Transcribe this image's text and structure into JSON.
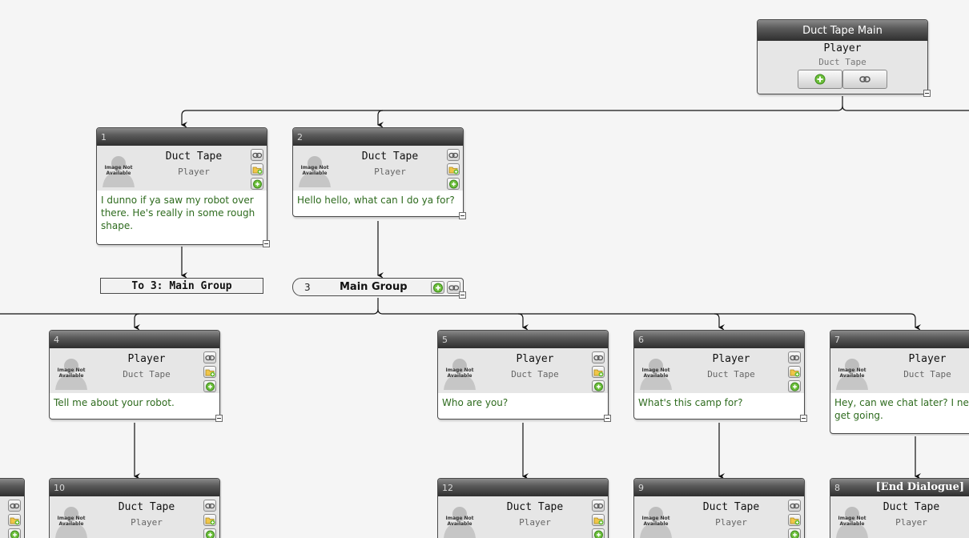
{
  "root": {
    "title": "Duct Tape Main",
    "speaker": "Player",
    "listener": "Duct Tape",
    "buttons": [
      "add-icon",
      "link-icon"
    ]
  },
  "portrait_text": "Image Not Available",
  "nodes": {
    "n1": {
      "id": "1",
      "speaker": "Duct Tape",
      "listener": "Player",
      "text": "I dunno if ya saw my robot over there. He's really in some rough shape."
    },
    "n2": {
      "id": "2",
      "speaker": "Duct Tape",
      "listener": "Player",
      "text": "Hello hello, what can I do ya for?"
    },
    "n4": {
      "id": "4",
      "speaker": "Player",
      "listener": "Duct Tape",
      "text": "Tell me about your robot."
    },
    "n5": {
      "id": "5",
      "speaker": "Player",
      "listener": "Duct Tape",
      "text": "Who are you?"
    },
    "n6": {
      "id": "6",
      "speaker": "Player",
      "listener": "Duct Tape",
      "text": "What's this camp for?"
    },
    "n7": {
      "id": "7",
      "speaker": "Player",
      "listener": "Duct Tape",
      "text": "Hey, can we chat later? I need to get going."
    },
    "n10": {
      "id": "10",
      "speaker": "Duct Tape",
      "listener": "Player"
    },
    "n12": {
      "id": "12",
      "speaker": "Duct Tape",
      "listener": "Player"
    },
    "n9": {
      "id": "9",
      "speaker": "Duct Tape",
      "listener": "Player"
    },
    "n8": {
      "id": "8",
      "speaker": "Duct Tape",
      "listener": "Player",
      "tag": "[End Dialogue]"
    }
  },
  "link_node": {
    "label": "To 3: Main Group"
  },
  "group_node": {
    "id": "3",
    "name": "Main Group"
  },
  "side_buttons": [
    "link-icon",
    "folder-add-icon",
    "add-icon"
  ],
  "colors": {
    "header_dark": "#2f2f2f",
    "text_green": "#2e6b1e",
    "background": "#f5f5f5"
  }
}
